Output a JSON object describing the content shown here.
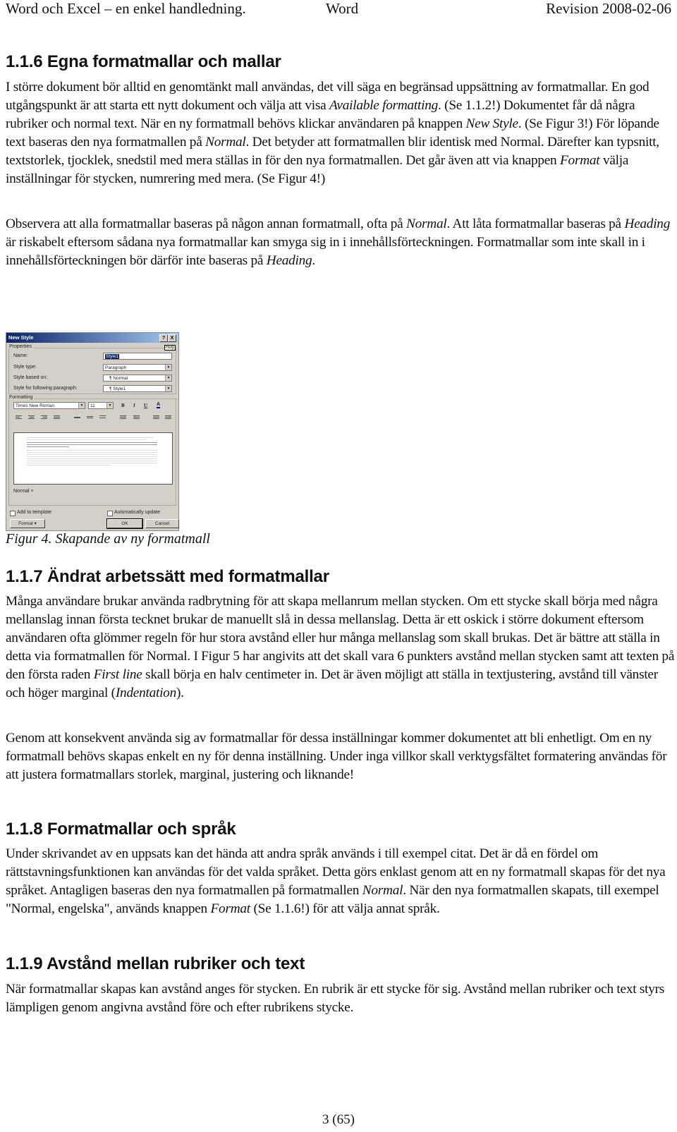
{
  "header": {
    "left": "Word och Excel – en enkel handledning.",
    "center": "Word",
    "right": "Revision 2008-02-06"
  },
  "sections": [
    {
      "heading": "1.1.6 Egna formatmallar och mallar",
      "paragraphs": [
        [
          {
            "t": "I större dokument bör alltid en genomtänkt mall användas, det vill säga en begränsad uppsättning av formatmallar. En god utgångspunkt är att starta ett nytt dokument och välja att visa "
          },
          {
            "t": "Available formatting",
            "i": true
          },
          {
            "t": ". (Se 1.1.2!) Dokumentet får då några rubriker och normal text. När en ny formatmall behövs klickar användaren på knappen "
          },
          {
            "t": "New Style",
            "i": true
          },
          {
            "t": ". (Se Figur 3!) För löpande text baseras den nya formatmallen på "
          },
          {
            "t": "Normal",
            "i": true
          },
          {
            "t": ". Det betyder att formatmallen blir identisk med Normal. Därefter kan typsnitt, textstorlek, tjocklek, snedstil med mera ställas in för den nya formatmallen. Det går även att via knappen "
          },
          {
            "t": "Format",
            "i": true
          },
          {
            "t": " välja inställningar för stycken, numrering med mera. (Se Figur 4!)"
          }
        ],
        [
          {
            "t": "Observera att alla formatmallar baseras på någon annan formatmall, ofta på "
          },
          {
            "t": "Normal",
            "i": true
          },
          {
            "t": ". Att låta formatmallar baseras på "
          },
          {
            "t": "Heading",
            "i": true
          },
          {
            "t": " är riskabelt eftersom sådana nya formatmallar kan smyga sig in i innehållsförteckningen. Formatmallar som inte skall in i innehållsförteckningen bör därför inte baseras på "
          },
          {
            "t": "Heading",
            "i": true
          },
          {
            "t": "."
          }
        ]
      ]
    },
    {
      "heading": "1.1.7 Ändrat arbetssätt med formatmallar",
      "paragraphs": [
        [
          {
            "t": "Många användare brukar använda radbrytning för att skapa mellanrum mellan stycken. Om ett stycke skall börja med några mellanslag innan första tecknet brukar de manuellt slå in dessa mellanslag. Detta är ett oskick i större dokument eftersom användaren ofta glömmer regeln för hur stora avstånd eller hur många mellanslag som skall brukas. Det är bättre att ställa in detta via formatmallen för Normal. I Figur 5 har angivits att det skall vara 6 punkters avstånd mellan stycken samt att texten på den första raden "
          },
          {
            "t": "First line",
            "i": true
          },
          {
            "t": " skall börja en halv centimeter in. Det är även möjligt att ställa in textjustering, avstånd till vänster och höger marginal ("
          },
          {
            "t": "Indentation",
            "i": true
          },
          {
            "t": ")."
          }
        ],
        [
          {
            "t": "Genom att konsekvent använda sig av formatmallar för dessa inställningar kommer dokumentet att bli enhetligt. Om en ny formatmall behövs skapas enkelt en ny för denna inställning. Under inga villkor skall verktygsfältet formatering användas för att justera formatmallars storlek, marginal, justering och liknande!"
          }
        ]
      ]
    },
    {
      "heading": "1.1.8 Formatmallar och språk",
      "paragraphs": [
        [
          {
            "t": "Under skrivandet av en uppsats kan det hända att andra språk används i till exempel citat. Det är då en fördel om rättstavningsfunktionen kan användas för det valda språket. Detta görs enklast genom att en ny formatmall skapas för det nya språket. Antagligen baseras den nya formatmallen på formatmallen "
          },
          {
            "t": "Normal",
            "i": true
          },
          {
            "t": ". När den nya formatmallen skapats, till exempel \"Normal, engelska\", används knappen "
          },
          {
            "t": "Format",
            "i": true
          },
          {
            "t": " (Se 1.1.6!) för att välja annat språk."
          }
        ]
      ]
    },
    {
      "heading": "1.1.9 Avstånd mellan rubriker och text",
      "paragraphs": [
        [
          {
            "t": "När formatmallar skapas kan avstånd anges för stycken. En rubrik är ett stycke för sig. Avstånd mellan rubriker och text styrs lämpligen genom angivna avstånd före och efter rubrikens stycke."
          }
        ]
      ]
    }
  ],
  "figure": {
    "caption": "Figur 4. Skapande av ny formatmall",
    "dialog": {
      "title": "New Style",
      "help_btn": "?",
      "close_btn": "X",
      "help_tooltip": "Help",
      "properties_label": "Properties",
      "name_label": "Name:",
      "name_value": "Style1",
      "style_type_label": "Style type:",
      "style_type_value": "Paragraph",
      "based_on_label": "Style based on:",
      "based_on_value": "¶ Normal",
      "following_label": "Style for following paragraph:",
      "following_value": "¶ Style1",
      "formatting_label": "Formatting",
      "font_value": "Times New Roman",
      "size_value": "11",
      "bold": "B",
      "italic": "I",
      "underline": "U",
      "font_color": "A",
      "description": "Normal +",
      "add_to_template": "Add to template",
      "auto_update": "Automatically update",
      "format_btn": "Format ▾",
      "ok_btn": "OK",
      "cancel_btn": "Cancel"
    }
  },
  "footer": {
    "page": "3 (65)"
  }
}
